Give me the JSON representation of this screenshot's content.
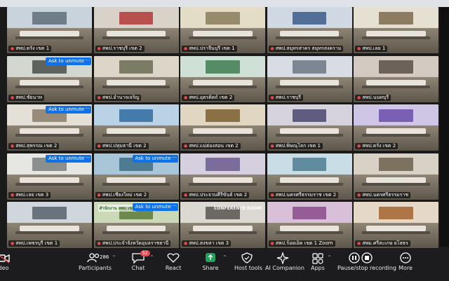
{
  "tiles": [
    {
      "name": "สพป.ตรัง เขต 1",
      "unmute": ""
    },
    {
      "name": "สพป.ราชบุรี เขต 2",
      "unmute": ""
    },
    {
      "name": "สพป.ปราจีนบุรี เขต 1",
      "unmute": ""
    },
    {
      "name": "สพป.สมุทรสาคร สมุทรสงคราม",
      "unmute": ""
    },
    {
      "name": "สพป.เลย 1",
      "unmute": ""
    },
    {
      "name": "สพป.ชัยนาท",
      "unmute": "Ask to unmute"
    },
    {
      "name": "สพป.อำนาจเจริญ",
      "unmute": ""
    },
    {
      "name": "สพป.อุตรดิตถ์ เขต 2",
      "unmute": ""
    },
    {
      "name": "สพป.ราชบุรี",
      "unmute": ""
    },
    {
      "name": "สพป.นนทบุรี",
      "unmute": ""
    },
    {
      "name": "สพป.สุพรรณ เขต 2",
      "unmute": "Ask to unmute"
    },
    {
      "name": "สพป.ปทุมธานี เขต 2",
      "unmute": ""
    },
    {
      "name": "สพป.แม่ฮ่องสอน เขต 2",
      "unmute": ""
    },
    {
      "name": "สพป.พิษณุโลก เขต 1",
      "unmute": ""
    },
    {
      "name": "สพป.ตรัง เขต 2",
      "unmute": ""
    },
    {
      "name": "สพป.เลย เขต 3",
      "unmute": "Ask to unmute"
    },
    {
      "name": "สพป.เชียงใหม่ เขต 2",
      "unmute": "Ask to unmute"
    },
    {
      "name": "สพป.ประจวบคีรีขันธ์ เขต 2",
      "unmute": ""
    },
    {
      "name": "สพป.นครศรีธรรมราช เขต 2",
      "unmute": ""
    },
    {
      "name": "สพป.นครศรีธรรมราช",
      "unmute": ""
    },
    {
      "name": "สพป.เพชรบุรี เขต 1",
      "unmute": ""
    },
    {
      "name": "สพป.ประจำจังหวัดอุบลราชธานี",
      "unmute": "Ask to unmute"
    },
    {
      "name": "สพป.สงขลา เขต 3",
      "unmute": ""
    },
    {
      "name": "สพป.ร้อยเอ็ด เขต 1 Zoom",
      "unmute": ""
    },
    {
      "name": "สพม.ศรีสะเกษ ยโสธร",
      "unmute": ""
    }
  ],
  "more_glyph": "···",
  "tile_overlay": {
    "sign_top": "CONFERENCE ROOM",
    "banner": "สำนักงาน ลพบ เขต"
  },
  "toolbar": {
    "video_label": "deo",
    "participants_label": "Participants",
    "participants_count": "286",
    "chat_label": "Chat",
    "chat_badge": "52",
    "react_label": "React",
    "share_label": "Share",
    "host_tools_label": "Host tools",
    "ai_label": "AI Companion",
    "apps_label": "Apps",
    "record_label": "Pause/stop recording",
    "more_label": "More"
  },
  "colors": {
    "share_green": "#1ea55a",
    "unmute_blue": "#0e72ed",
    "badge_red": "#e5484d",
    "toolbar_bg": "#1c1c1e"
  }
}
